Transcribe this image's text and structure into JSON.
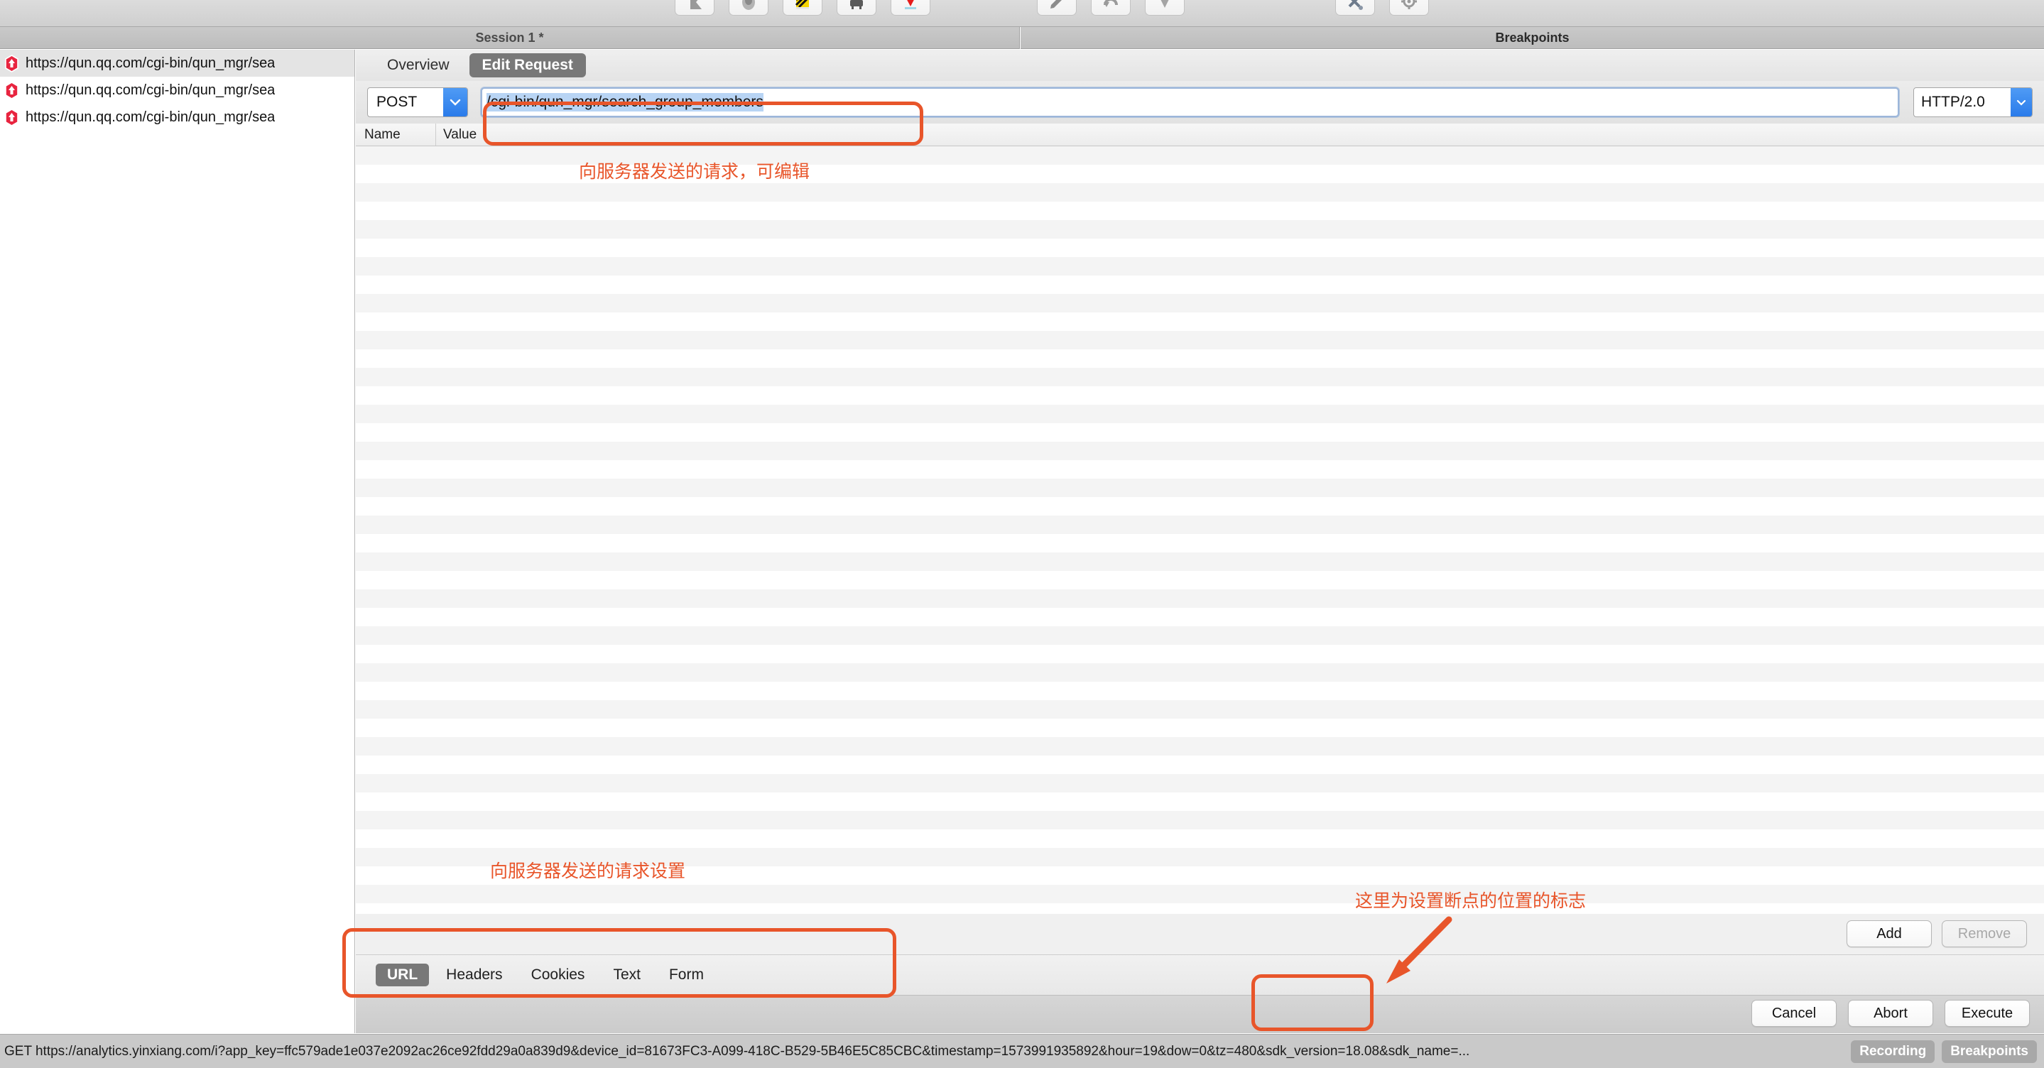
{
  "toolbar": {
    "buttons": [
      {
        "name": "flag-icon"
      },
      {
        "name": "record-icon"
      },
      {
        "name": "throttle-icon"
      },
      {
        "name": "clear-icon"
      },
      {
        "name": "stop-icon"
      },
      {
        "name": "pencil-icon"
      },
      {
        "name": "repeat-icon"
      },
      {
        "name": "down-arrow-icon"
      },
      {
        "name": "tools-icon"
      },
      {
        "name": "settings-icon"
      }
    ]
  },
  "header": {
    "session_title": "Session 1 *",
    "breakpoints_title": "Breakpoints"
  },
  "sidebar": {
    "rows": [
      {
        "icon": "breakpoint-up-icon",
        "url": "https://qun.qq.com/cgi-bin/qun_mgr/sea",
        "selected": true
      },
      {
        "icon": "breakpoint-up-icon",
        "url": "https://qun.qq.com/cgi-bin/qun_mgr/sea",
        "selected": false
      },
      {
        "icon": "breakpoint-up-icon",
        "url": "https://qun.qq.com/cgi-bin/qun_mgr/sea",
        "selected": false
      }
    ]
  },
  "main": {
    "tabs": [
      {
        "label": "Overview",
        "active": false
      },
      {
        "label": "Edit Request",
        "active": true
      }
    ],
    "request": {
      "method": "POST",
      "url_value": "/cgi-bin/qun_mgr/search_group_members",
      "protocol": "HTTP/2.0"
    },
    "columns": {
      "name": "Name",
      "value": "Value"
    },
    "add_label": "Add",
    "remove_label": "Remove",
    "bottom_tabs": [
      {
        "label": "URL",
        "active": true
      },
      {
        "label": "Headers",
        "active": false
      },
      {
        "label": "Cookies",
        "active": false
      },
      {
        "label": "Text",
        "active": false
      },
      {
        "label": "Form",
        "active": false
      }
    ],
    "actions": [
      {
        "label": "Cancel"
      },
      {
        "label": "Abort"
      },
      {
        "label": "Execute"
      }
    ]
  },
  "annotations": {
    "request_editable": "向服务器发送的请求，可编辑",
    "request_settings": "向服务器发送的请求设置",
    "breakpoint_marker": "这里为设置断点的位置的标志"
  },
  "statusbar": {
    "url": "GET https://analytics.yinxiang.com/i?app_key=ffc579ade1e037e2092ac26ce92fdd29a0a839d9&device_id=81673FC3-A099-418C-B529-5B46E5C85CBC&timestamp=1573991935892&hour=19&dow=0&tz=480&sdk_version=18.08&sdk_name=...",
    "recording_label": "Recording",
    "breakpoints_label": "Breakpoints"
  },
  "colors": {
    "accent_annotation": "#e8552a",
    "tab_active_bg": "#787878",
    "select_caret_blue": "#2a7bea",
    "selection_blue": "#b8d4f4",
    "breakpoint_red": "#e8243f"
  }
}
